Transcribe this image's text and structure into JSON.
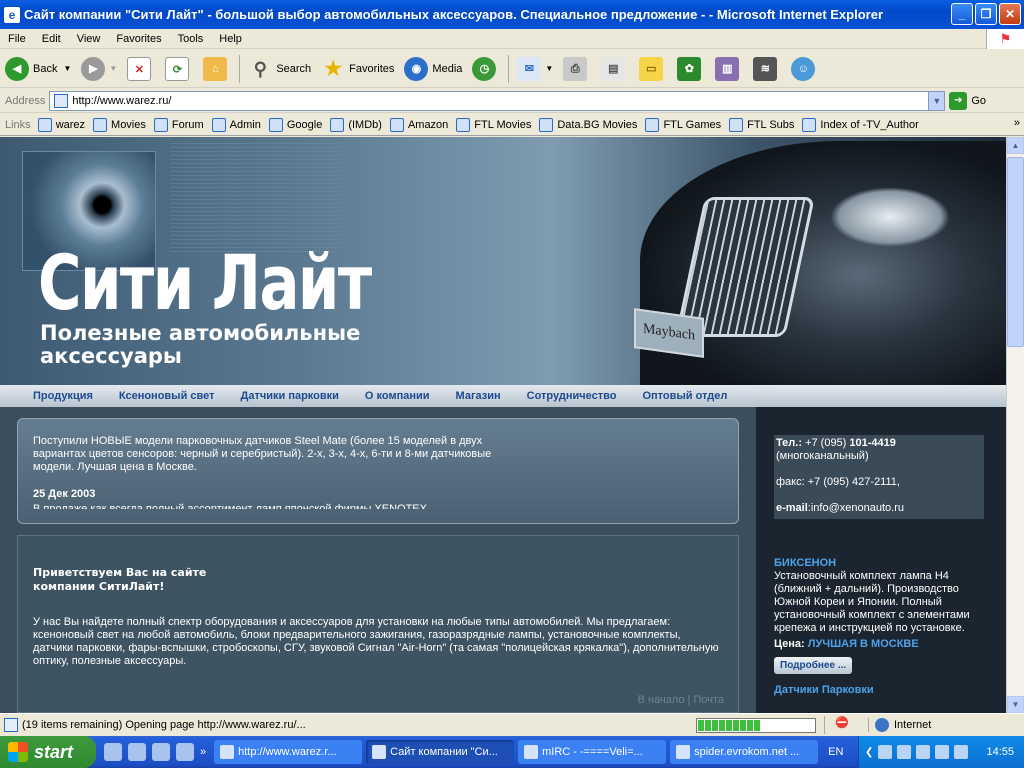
{
  "window": {
    "title": "Сайт компании \"Сити Лайт\" - большой выбор автомобильных аксессуаров. Специальное предложение -  - Microsoft Internet Explorer",
    "min_icon": "minimize-icon",
    "max_icon": "maximize-icon",
    "close_icon": "close-icon"
  },
  "menu": [
    "File",
    "Edit",
    "View",
    "Favorites",
    "Tools",
    "Help"
  ],
  "toolbar": {
    "back": "Back",
    "search": "Search",
    "favorites": "Favorites",
    "media": "Media"
  },
  "address": {
    "label": "Address",
    "url": "http://www.warez.ru/",
    "go": "Go"
  },
  "links": {
    "label": "Links",
    "items": [
      "warez",
      "Movies",
      "Forum",
      "Admin",
      "Google",
      "(IMDb)",
      "Amazon",
      "FTL Movies",
      "Data.BG Movies",
      "FTL Games",
      "FTL Subs",
      "Index of -TV_Author"
    ]
  },
  "site": {
    "brand": "Сити Лайт",
    "slogan_line1": "Полезные автомобильные",
    "slogan_line2": "аксессуары",
    "plate": "Maybach",
    "nav": [
      "Продукция",
      "Ксеноновый свет",
      "Датчики парковки",
      "О компании",
      "Магазин",
      "Сотрудничество",
      "Оптовый отдел"
    ],
    "news_text": "Поступили НОВЫЕ модели парковочных датчиков Steel Mate (более 15 моделей в двух вариантах цветов сенсоров: черный и серебристый). 2-х, 3-х, 4-х, 6-ти и 8-ми датчиковые модели. Лучшая цена в Москве.",
    "news_date": "25 Дек 2003",
    "news_trunc": "В продаже как всегда полный ассортимент ламп японской фирмы XENOTEX",
    "welcome_title": "Приветствуем Вас на сайте компании СитиЛайт!",
    "welcome_text": "У нас Вы найдете полный спектр оборудования и аксессуаров для установки на любые типы автомобилей. Мы предлагаем: ксеноновый свет на любой автомобиль, блоки предварительного зажигания, газоразрядные лампы, установочные комплекты, датчики парковки, фары-вспышки, стробоскопы, СГУ, звуковой Сигнал \"Air-Horn\" (та самая \"полицейская крякалка\"), дополнительную оптику, полезные аксессуары.",
    "pager": "В начало  |  Почта",
    "phone_label": "Тел.:",
    "phone_prefix": "+7 (095)",
    "phone_number": "101-4419",
    "phone_note": "(многоканальный)",
    "fax": "факс: +7 (095) 427-2111,",
    "email_label": "e-mail",
    "email": ":info@xenonauto.ru",
    "promo_title": "БИКСЕНОН",
    "promo_text": "Установочный комплект лампа H4 (ближний + дальний). Производство Южной Кореи и Японии. Полный установочный комплект с элементами крепежа и инструкцией по установке.",
    "price_label": "Цена:",
    "price_value": "ЛУЧШАЯ В МОСКВЕ",
    "more_button": "Подробнее ...",
    "promo2_title": "Датчики Парковки"
  },
  "status": {
    "text": "(19 items remaining) Opening page http://www.warez.ru/...",
    "progress": 0.55,
    "zone": "Internet"
  },
  "taskbar": {
    "start": "start",
    "tasks": [
      {
        "label": "http://www.warez.r...",
        "active": false
      },
      {
        "label": "Сайт компании \"Си...",
        "active": true
      },
      {
        "label": "mIRC - -====Veli=...",
        "active": false
      },
      {
        "label": "spider.evrokom.net ...",
        "active": false
      }
    ],
    "lang": "EN",
    "clock": "14:55"
  },
  "colors": {
    "title_blue": "#0a52d6",
    "link_blue": "#4da2e8",
    "nav_text": "#1c4a90",
    "page_bg": "#2f3d48"
  }
}
